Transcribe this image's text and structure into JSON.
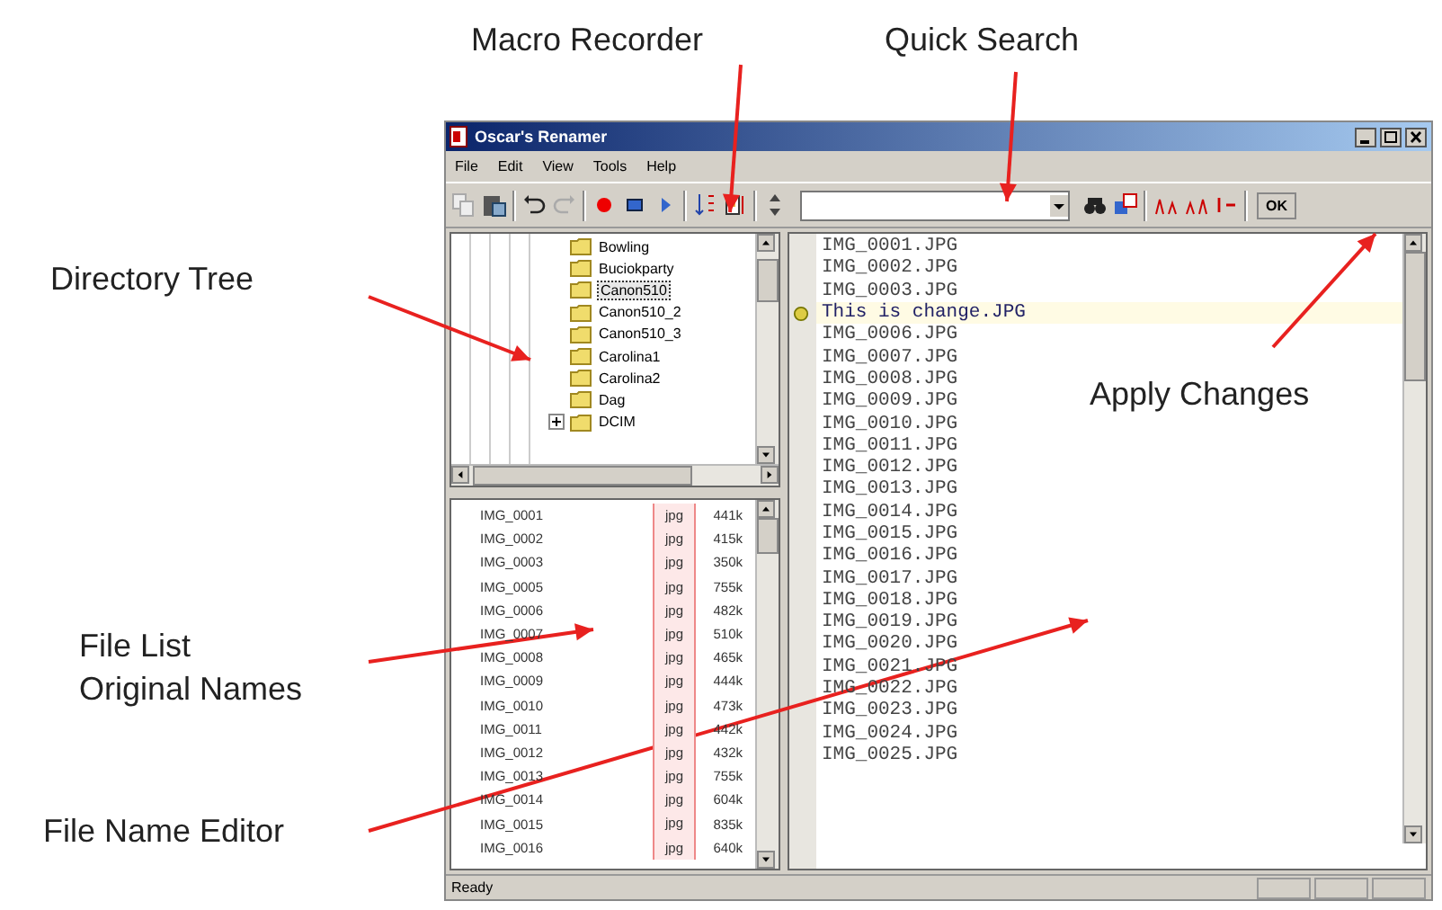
{
  "annotations": [
    {
      "text": "Macro Recorder"
    },
    {
      "text": "Quick Search"
    },
    {
      "text": "Directory Tree"
    },
    {
      "text": "Apply Changes"
    },
    {
      "text": "File List\nOriginal Names"
    },
    {
      "text": "File Name Editor"
    }
  ],
  "window": {
    "title": "Oscar's Renamer"
  },
  "menu": [
    "File",
    "Edit",
    "View",
    "Tools",
    "Help"
  ],
  "toolbar": {
    "ok_label": "OK"
  },
  "tree": [
    {
      "label": "Bowling",
      "selected": false,
      "expandable": false
    },
    {
      "label": "Buciokparty",
      "selected": false,
      "expandable": false
    },
    {
      "label": "Canon510",
      "selected": true,
      "expandable": false
    },
    {
      "label": "Canon510_2",
      "selected": false,
      "expandable": false
    },
    {
      "label": "Canon510_3",
      "selected": false,
      "expandable": false
    },
    {
      "label": "Carolina1",
      "selected": false,
      "expandable": false
    },
    {
      "label": "Carolina2",
      "selected": false,
      "expandable": false
    },
    {
      "label": "Dag",
      "selected": false,
      "expandable": false
    },
    {
      "label": "DCIM",
      "selected": false,
      "expandable": true
    }
  ],
  "files": [
    {
      "name": "IMG_0001",
      "ext": "jpg",
      "size": "441k"
    },
    {
      "name": "IMG_0002",
      "ext": "jpg",
      "size": "415k"
    },
    {
      "name": "IMG_0003",
      "ext": "jpg",
      "size": "350k"
    },
    {
      "name": "IMG_0005",
      "ext": "jpg",
      "size": "755k"
    },
    {
      "name": "IMG_0006",
      "ext": "jpg",
      "size": "482k"
    },
    {
      "name": "IMG_0007",
      "ext": "jpg",
      "size": "510k"
    },
    {
      "name": "IMG_0008",
      "ext": "jpg",
      "size": "465k"
    },
    {
      "name": "IMG_0009",
      "ext": "jpg",
      "size": "444k"
    },
    {
      "name": "IMG_0010",
      "ext": "jpg",
      "size": "473k"
    },
    {
      "name": "IMG_0011",
      "ext": "jpg",
      "size": "442k"
    },
    {
      "name": "IMG_0012",
      "ext": "jpg",
      "size": "432k"
    },
    {
      "name": "IMG_0013",
      "ext": "jpg",
      "size": "755k"
    },
    {
      "name": "IMG_0014",
      "ext": "jpg",
      "size": "604k"
    },
    {
      "name": "IMG_0015",
      "ext": "jpg",
      "size": "835k"
    },
    {
      "name": "IMG_0016",
      "ext": "jpg",
      "size": "640k"
    }
  ],
  "editor": [
    {
      "text": "IMG_0001.JPG",
      "edited": false
    },
    {
      "text": "IMG_0002.JPG",
      "edited": false
    },
    {
      "text": "IMG_0003.JPG",
      "edited": false
    },
    {
      "text": "This is change.JPG",
      "edited": true
    },
    {
      "text": "IMG_0006.JPG",
      "edited": false
    },
    {
      "text": "IMG_0007.JPG",
      "edited": false
    },
    {
      "text": "IMG_0008.JPG",
      "edited": false
    },
    {
      "text": "IMG_0009.JPG",
      "edited": false
    },
    {
      "text": "IMG_0010.JPG",
      "edited": false
    },
    {
      "text": "IMG_0011.JPG",
      "edited": false
    },
    {
      "text": "IMG_0012.JPG",
      "edited": false
    },
    {
      "text": "IMG_0013.JPG",
      "edited": false
    },
    {
      "text": "IMG_0014.JPG",
      "edited": false
    },
    {
      "text": "IMG_0015.JPG",
      "edited": false
    },
    {
      "text": "IMG_0016.JPG",
      "edited": false
    },
    {
      "text": "IMG_0017.JPG",
      "edited": false
    },
    {
      "text": "IMG_0018.JPG",
      "edited": false
    },
    {
      "text": "IMG_0019.JPG",
      "edited": false
    },
    {
      "text": "IMG_0020.JPG",
      "edited": false
    },
    {
      "text": "IMG_0021.JPG",
      "edited": false
    },
    {
      "text": "IMG_0022.JPG",
      "edited": false
    },
    {
      "text": "IMG_0023.JPG",
      "edited": false
    },
    {
      "text": "IMG_0024.JPG",
      "edited": false
    },
    {
      "text": "IMG_0025.JPG",
      "edited": false
    }
  ],
  "status_bar": {
    "text": "Ready"
  }
}
